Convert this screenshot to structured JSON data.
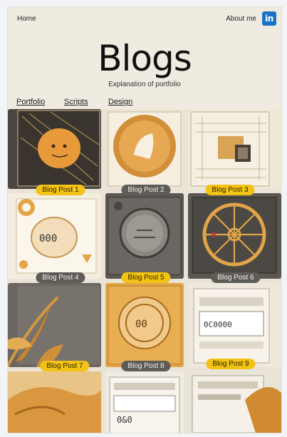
{
  "header": {
    "home": "Home",
    "about": "About me",
    "linkedin_glyph": "in"
  },
  "hero": {
    "title": "Blogs",
    "subtitle": "Explanation of portfolio"
  },
  "nav": {
    "items": [
      "Portfolio",
      "Scripts",
      "Design"
    ]
  },
  "posts": [
    {
      "label": "Blog Post 1",
      "pill": "yellow"
    },
    {
      "label": "Blog Post 2",
      "pill": "gray"
    },
    {
      "label": "Blog Post 3",
      "pill": "yellow"
    },
    {
      "label": "Blog Post 4",
      "pill": "gray"
    },
    {
      "label": "Blog Post 5",
      "pill": "yellow"
    },
    {
      "label": "Blog Post 6",
      "pill": "gray"
    },
    {
      "label": "Blog Post 7",
      "pill": "yellow"
    },
    {
      "label": "Blog Post 8",
      "pill": "gray"
    },
    {
      "label": "Blog Post 9",
      "pill": "yellow"
    }
  ],
  "colors": {
    "accent": "#f2c314",
    "linkedin": "#1a73c8",
    "background": "#efebe0"
  }
}
